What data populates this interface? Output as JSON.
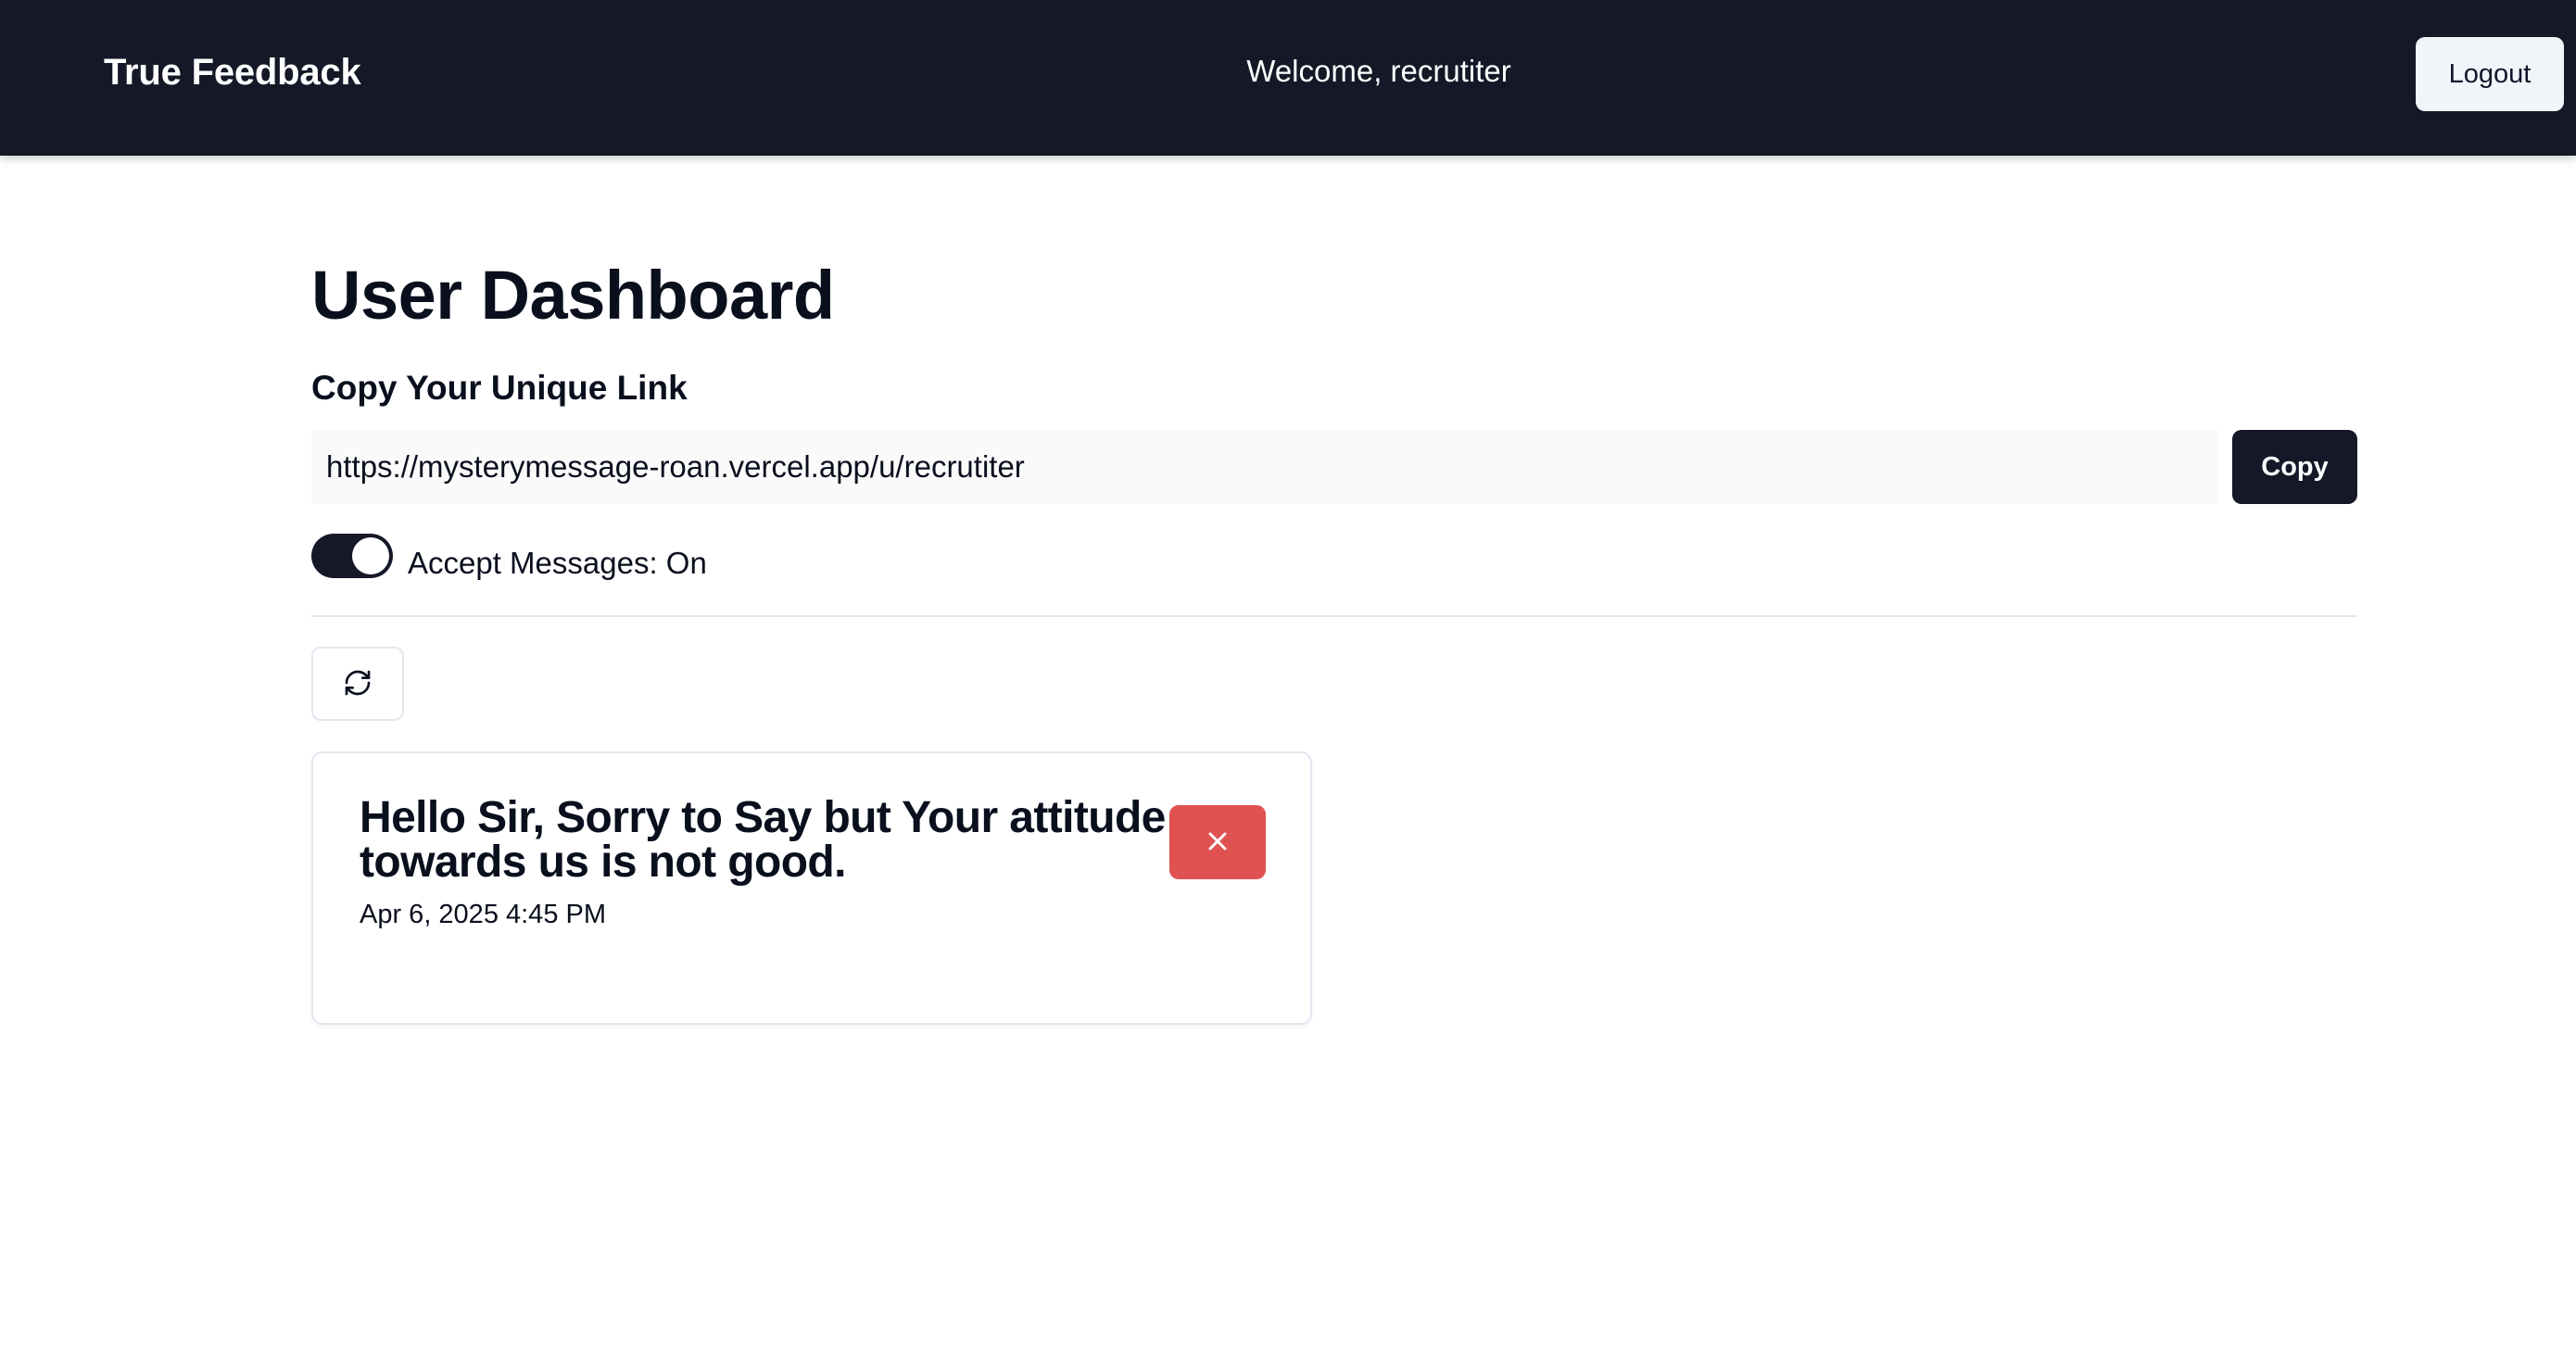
{
  "navbar": {
    "brand": "True Feedback",
    "welcome": "Welcome, recrutiter",
    "logout_label": "Logout"
  },
  "dashboard": {
    "title": "User Dashboard",
    "link_heading": "Copy Your Unique Link",
    "unique_link": "https://mysterymessage-roan.vercel.app/u/recrutiter",
    "copy_label": "Copy",
    "accept_messages_label": "Accept Messages: On",
    "accept_messages_on": true,
    "refresh_icon": "refresh-icon"
  },
  "messages": [
    {
      "content": "Hello Sir, Sorry to Say but Your attitude towards us is not good.",
      "date": "Apr 6, 2025 4:45 PM",
      "delete_icon": "close-icon"
    }
  ],
  "colors": {
    "navbar_bg": "#141827",
    "primary_button": "#141827",
    "delete_button": "#e05252",
    "logout_button_bg": "#f1f5f9"
  }
}
